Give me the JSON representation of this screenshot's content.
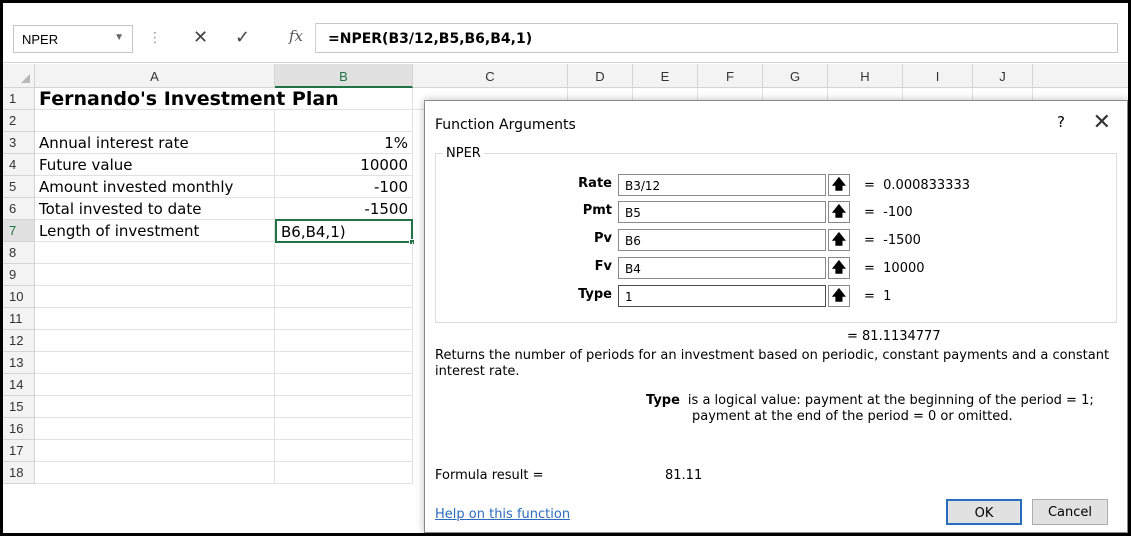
{
  "formula_bar": {
    "name_box": "NPER",
    "cancel_icon": "✕",
    "enter_icon": "✓",
    "fx_label": "fx",
    "formula": "=NPER(B3/12,B5,B6,B4,1)"
  },
  "sheet": {
    "columns": [
      "A",
      "B",
      "C",
      "D",
      "E",
      "F",
      "G",
      "H",
      "I",
      "J"
    ],
    "rows": [
      "1",
      "2",
      "3",
      "4",
      "5",
      "6",
      "7",
      "8",
      "9",
      "10",
      "11",
      "12",
      "13",
      "14",
      "15",
      "16",
      "17",
      "18"
    ],
    "cells": {
      "a1": "Fernando's Investment Plan",
      "a3": "Annual interest rate",
      "b3": "1%",
      "a4": "Future value",
      "b4": "10000",
      "a5": "Amount invested monthly",
      "b5": "-100",
      "a6": "Total invested to date",
      "b6": "-1500",
      "a7": "Length of investment",
      "b7": "B6,B4,1)"
    }
  },
  "dialog": {
    "title": "Function Arguments",
    "help_char": "?",
    "close_char": "✕",
    "group_label": "NPER",
    "args": [
      {
        "label": "Rate",
        "value": "B3/12",
        "result": "=  0.000833333"
      },
      {
        "label": "Pmt",
        "value": "B5",
        "result": "=  -100"
      },
      {
        "label": "Pv",
        "value": "B6",
        "result": "=  -1500"
      },
      {
        "label": "Fv",
        "value": "B4",
        "result": "=  10000"
      },
      {
        "label": "Type",
        "value": "1",
        "result": "=  1"
      }
    ],
    "result_line": "=  81.1134777",
    "description": "Returns the number of periods for an investment based on periodic, constant payments and a constant interest rate.",
    "arg_desc_name": "Type",
    "arg_desc_line1": "is a logical value: payment at the beginning of the period = 1;",
    "arg_desc_line2": "payment at the end of the period = 0 or omitted.",
    "formula_result_label": "Formula result =",
    "formula_result_value": "81.11",
    "help_link": "Help on this function",
    "ok_label": "OK",
    "cancel_label": "Cancel",
    "ref_icon": "🡅"
  },
  "colors": {
    "excel_green": "#217346",
    "link_blue": "#2b6cbf"
  }
}
